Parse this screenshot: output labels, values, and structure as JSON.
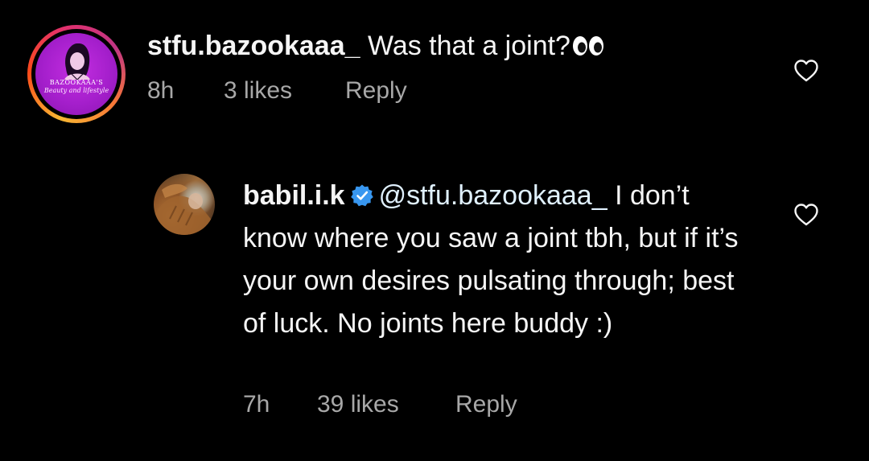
{
  "colors": {
    "background": "#000000",
    "text_primary": "#f5f5f5",
    "text_secondary": "#a8a8a8",
    "verified_badge": "#3897f0",
    "mention": "#e0f1ff"
  },
  "comments": [
    {
      "username": "stfu.bazookaaa_",
      "text": "Was that a joint?",
      "emoji_icon": "eyes-emoji",
      "avatar": {
        "brand_line1": "BAZOOKAAA'S",
        "brand_line2": "Beauty and lifestyle"
      },
      "time": "8h",
      "likes": "3 likes",
      "reply_label": "Reply",
      "like_icon": "heart-outline-icon"
    }
  ],
  "replies": [
    {
      "username": "babil.i.k",
      "verified": true,
      "mention": "@stfu.bazookaaa_",
      "text": " I don’t know where you saw a joint tbh, but if it’s your own desires pulsating through; best of luck. No joints here buddy :)",
      "time": "7h",
      "likes": "39 likes",
      "reply_label": "Reply",
      "like_icon": "heart-outline-icon"
    }
  ]
}
